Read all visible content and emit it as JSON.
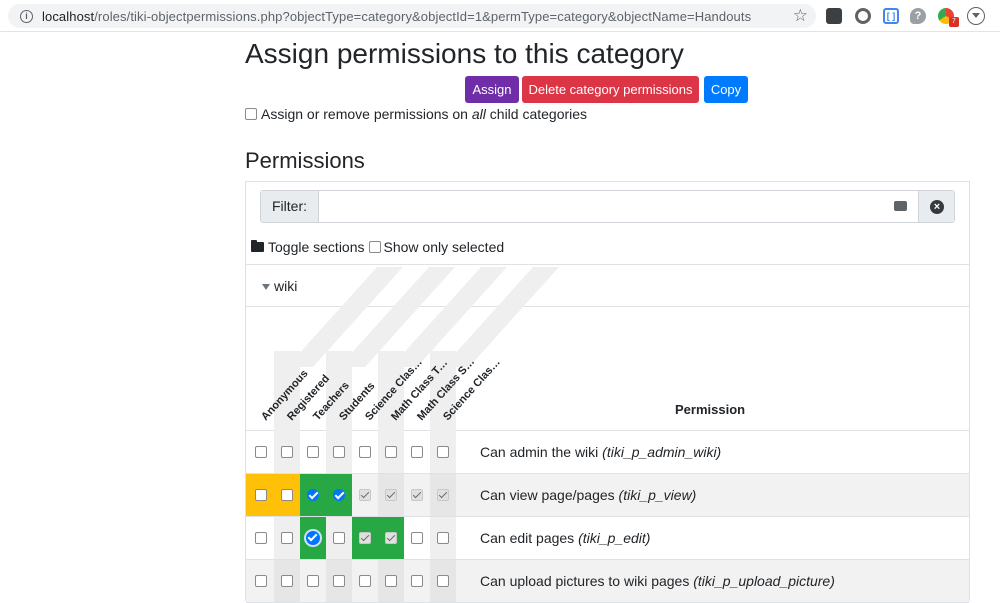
{
  "browser": {
    "url_host": "localhost",
    "url_rest": "/roles/tiki-objectpermissions.php?objectType=category&objectId=1&permType=category&objectName=Handouts",
    "ext_badge": "7"
  },
  "page": {
    "title": "Assign permissions to this category",
    "buttons": {
      "assign": "Assign",
      "delete": "Delete category permissions",
      "copy": "Copy"
    },
    "child_pre": "Assign or remove permissions on ",
    "child_em": "all",
    "child_post": " child categories",
    "permissions_heading": "Permissions",
    "filter_label": "Filter:",
    "filter_value": "",
    "toggle_sections": "Toggle sections",
    "show_only_selected": "Show only selected",
    "section_name": "wiki"
  },
  "table": {
    "groups": [
      "Anonymous",
      "Registered",
      "Teachers",
      "Students",
      "Science Class T...",
      "Math Class Teac...",
      "Math Class Stud...",
      "Science Class St..."
    ],
    "permission_header": "Permission",
    "rows": [
      {
        "label": "Can admin the wiki",
        "code": "(tiki_p_admin_wiki)"
      },
      {
        "label": "Can view page/pages",
        "code": "(tiki_p_view)"
      },
      {
        "label": "Can edit pages",
        "code": "(tiki_p_edit)"
      },
      {
        "label": "Can upload pictures to wiki pages",
        "code": "(tiki_p_upload_picture)"
      }
    ]
  },
  "colors": {
    "assign": "#6f2da8",
    "delete": "#dc3545",
    "copy": "#007bff",
    "inherited_anon": "#ffc107",
    "granted": "#28a745",
    "checkbox_checked": "#0075ff"
  }
}
